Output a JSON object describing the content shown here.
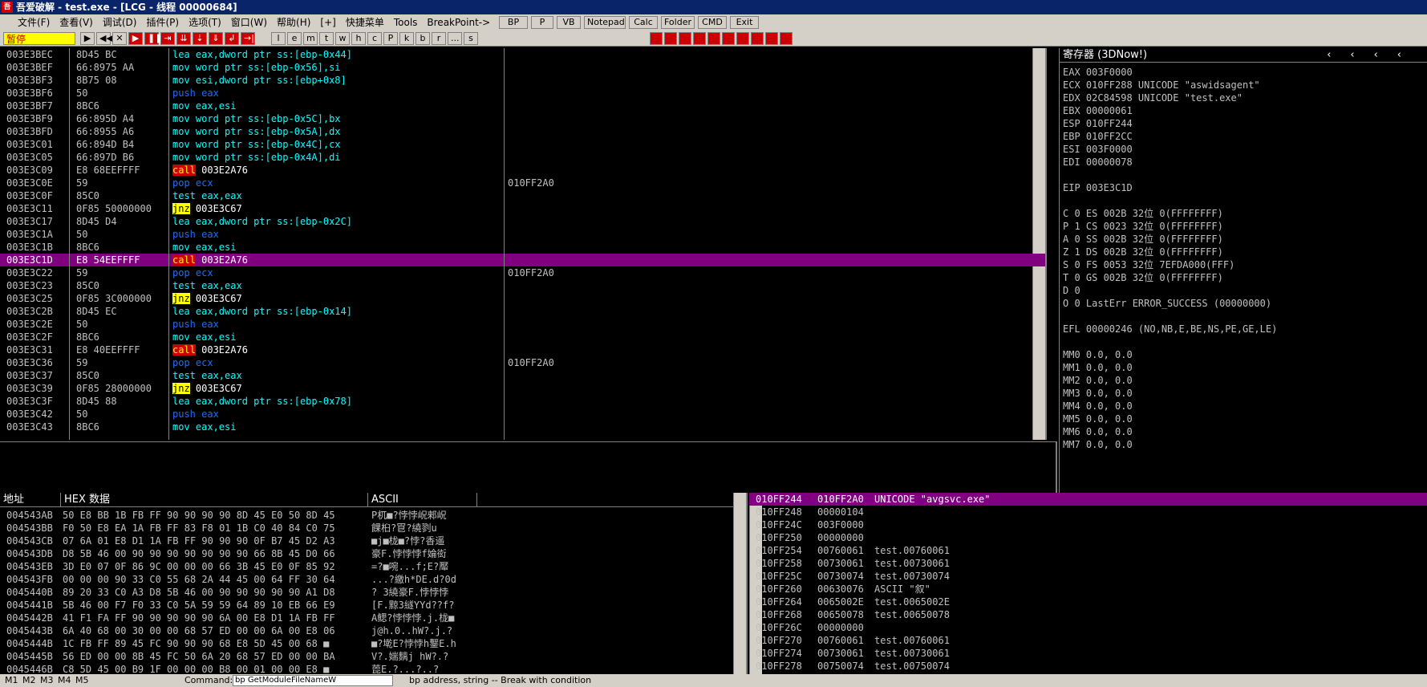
{
  "title": "吾爱破解 - test.exe - [LCG - 线程 00000684]",
  "menu": [
    "文件(F)",
    "查看(V)",
    "调试(D)",
    "插件(P)",
    "选项(T)",
    "窗口(W)",
    "帮助(H)",
    "[+]",
    "快捷菜单",
    "Tools",
    "BreakPoint->"
  ],
  "status": "暂停",
  "toolbar_letters": [
    "l",
    "e",
    "m",
    "t",
    "w",
    "h",
    "c",
    "P",
    "k",
    "b",
    "r",
    "...",
    "s"
  ],
  "quick_buttons": [
    "BP",
    "P",
    "VB",
    "Notepad",
    "Calc",
    "Folder",
    "CMD",
    "Exit"
  ],
  "disasm": [
    {
      "addr": "003E3BEC",
      "bytes": "8D45 BC",
      "op": "lea",
      "args": " eax,dword ptr ss:[ebp-0x44]",
      "cmt": ""
    },
    {
      "addr": "003E3BEF",
      "bytes": "66:8975 AA",
      "op": "mov",
      "args": " word ptr ss:[ebp-0x56],si",
      "cmt": ""
    },
    {
      "addr": "003E3BF3",
      "bytes": "8B75 08",
      "op": "mov",
      "args": " esi,dword ptr ss:[ebp+0x8]",
      "cmt": ""
    },
    {
      "addr": "003E3BF6",
      "bytes": "50",
      "op": "push",
      "args": " eax",
      "cmt": ""
    },
    {
      "addr": "003E3BF7",
      "bytes": "8BC6",
      "op": "mov",
      "args": " eax,esi",
      "cmt": ""
    },
    {
      "addr": "003E3BF9",
      "bytes": "66:895D A4",
      "op": "mov",
      "args": " word ptr ss:[ebp-0x5C],bx",
      "cmt": ""
    },
    {
      "addr": "003E3BFD",
      "bytes": "66:8955 A6",
      "op": "mov",
      "args": " word ptr ss:[ebp-0x5A],dx",
      "cmt": ""
    },
    {
      "addr": "003E3C01",
      "bytes": "66:894D B4",
      "op": "mov",
      "args": " word ptr ss:[ebp-0x4C],cx",
      "cmt": ""
    },
    {
      "addr": "003E3C05",
      "bytes": "66:897D B6",
      "op": "mov",
      "args": " word ptr ss:[ebp-0x4A],di",
      "cmt": ""
    },
    {
      "addr": "003E3C09",
      "bytes": "E8 68EEFFFF",
      "op": "call",
      "args": " 003E2A76",
      "cmt": ""
    },
    {
      "addr": "003E3C0E",
      "bytes": "59",
      "op": "pop",
      "args": " ecx",
      "cmt": "010FF2A0"
    },
    {
      "addr": "003E3C0F",
      "bytes": "85C0",
      "op": "test",
      "args": " eax,eax",
      "cmt": ""
    },
    {
      "addr": "003E3C11",
      "bytes": "0F85 50000000",
      "op": "jnz",
      "args": " 003E3C67",
      "cmt": ""
    },
    {
      "addr": "003E3C17",
      "bytes": "8D45 D4",
      "op": "lea",
      "args": " eax,dword ptr ss:[ebp-0x2C]",
      "cmt": ""
    },
    {
      "addr": "003E3C1A",
      "bytes": "50",
      "op": "push",
      "args": " eax",
      "cmt": ""
    },
    {
      "addr": "003E3C1B",
      "bytes": "8BC6",
      "op": "mov",
      "args": " eax,esi",
      "cmt": ""
    },
    {
      "addr": "003E3C1D",
      "bytes": "E8 54EEFFFF",
      "op": "call",
      "args": " 003E2A76",
      "cmt": "",
      "sel": true
    },
    {
      "addr": "003E3C22",
      "bytes": "59",
      "op": "pop",
      "args": " ecx",
      "cmt": "010FF2A0"
    },
    {
      "addr": "003E3C23",
      "bytes": "85C0",
      "op": "test",
      "args": " eax,eax",
      "cmt": ""
    },
    {
      "addr": "003E3C25",
      "bytes": "0F85 3C000000",
      "op": "jnz",
      "args": " 003E3C67",
      "cmt": ""
    },
    {
      "addr": "003E3C2B",
      "bytes": "8D45 EC",
      "op": "lea",
      "args": " eax,dword ptr ss:[ebp-0x14]",
      "cmt": ""
    },
    {
      "addr": "003E3C2E",
      "bytes": "50",
      "op": "push",
      "args": " eax",
      "cmt": ""
    },
    {
      "addr": "003E3C2F",
      "bytes": "8BC6",
      "op": "mov",
      "args": " eax,esi",
      "cmt": ""
    },
    {
      "addr": "003E3C31",
      "bytes": "E8 40EEFFFF",
      "op": "call",
      "args": " 003E2A76",
      "cmt": ""
    },
    {
      "addr": "003E3C36",
      "bytes": "59",
      "op": "pop",
      "args": " ecx",
      "cmt": "010FF2A0"
    },
    {
      "addr": "003E3C37",
      "bytes": "85C0",
      "op": "test",
      "args": " eax,eax",
      "cmt": ""
    },
    {
      "addr": "003E3C39",
      "bytes": "0F85 28000000",
      "op": "jnz",
      "args": " 003E3C67",
      "cmt": ""
    },
    {
      "addr": "003E3C3F",
      "bytes": "8D45 88",
      "op": "lea",
      "args": " eax,dword ptr ss:[ebp-0x78]",
      "cmt": ""
    },
    {
      "addr": "003E3C42",
      "bytes": "50",
      "op": "push",
      "args": " eax",
      "cmt": ""
    },
    {
      "addr": "003E3C43",
      "bytes": "8BC6",
      "op": "mov",
      "args": " eax,esi",
      "cmt": ""
    }
  ],
  "registers_title": "寄存器 (3DNow!)",
  "registers": [
    "EAX 003F0000",
    "ECX 010FF288 UNICODE \"aswidsagent\"",
    "EDX 02C84598 UNICODE \"test.exe\"",
    "EBX 00000061",
    "ESP 010FF244",
    "EBP 010FF2CC",
    "ESI 003F0000",
    "EDI 00000078",
    "",
    "EIP 003E3C1D",
    "",
    "C 0  ES 002B 32位 0(FFFFFFFF)",
    "P 1  CS 0023 32位 0(FFFFFFFF)",
    "A 0  SS 002B 32位 0(FFFFFFFF)",
    "Z 1  DS 002B 32位 0(FFFFFFFF)",
    "S 0  FS 0053 32位 7EFDA000(FFF)",
    "T 0  GS 002B 32位 0(FFFFFFFF)",
    "D 0",
    "O 0  LastErr ERROR_SUCCESS (00000000)",
    "",
    "EFL 00000246 (NO,NB,E,BE,NS,PE,GE,LE)",
    "",
    "MM0            0.0,           0.0",
    "MM1            0.0,           0.0",
    "MM2            0.0,           0.0",
    "MM3            0.0,           0.0",
    "MM4            0.0,           0.0",
    "MM5            0.0,           0.0",
    "MM6            0.0,           0.0",
    "MM7            0.0,           0.0"
  ],
  "dump_headers": {
    "addr": "地址",
    "hex": "HEX 数据",
    "ascii": "ASCII"
  },
  "dump": [
    {
      "addr": "004543AB",
      "hex": "50 E8 BB 1B FB FF 90 90 90 90 8D 45 E0 50 8D 45",
      "ascii": "P杌■?悖悖岲郲岲"
    },
    {
      "addr": "004543BB",
      "hex": "F0 50 E8 EA 1A FB FF 83 F8 01 1B C0 40 84 C0 75",
      "ascii": "餜桕?冟?繞剹u"
    },
    {
      "addr": "004543CB",
      "hex": "07 6A 01 E8 D1 1A FB FF 90 90 90 0F B7 45 D2 A3",
      "ascii": "■j■栊■?悖?香遥"
    },
    {
      "addr": "004543DB",
      "hex": "D8 5B 46 00 90 90 90 90 90 90 90 66 8B 45 D0 66",
      "ascii": "豪F.悖悖悖f婨衒"
    },
    {
      "addr": "004543EB",
      "hex": "3D E0 07 0F 86 9C 00 00 00 66 3B 45 E0 0F 85 92",
      "ascii": "=?■啘...f;E?厴"
    },
    {
      "addr": "004543FB",
      "hex": "00 00 00 90 33 C0 55 68 2A 44 45 00 64 FF 30 64",
      "ascii": "...?繳h*DE.d?0d"
    },
    {
      "addr": "0045440B",
      "hex": "89 20 33 C0 A3 D8 5B 46 00 90 90 90 90 90 A1 D8",
      "ascii": "? 3繞豪F.悖悖悖"
    },
    {
      "addr": "0045441B",
      "hex": "5B 46 00 F7 F0 33 C0 5A 59 59 64 89 10 EB 66 E9",
      "ascii": "[F.黥3繸YYd??f?"
    },
    {
      "addr": "0045442B",
      "hex": "41 F1 FA FF 90 90 90 90 90 6A 00 E8 D1 1A FB FF",
      "ascii": "A鳃?悖悖悖.j.栊■"
    },
    {
      "addr": "0045443B",
      "hex": "6A 40 68 00 30 00 00 68 57 ED 00 00 6A 00 E8 06",
      "ascii": "j@h.0..hW?.j.?"
    },
    {
      "addr": "0045444B",
      "hex": "1C FB FF 89 45 FC 90 90 90 68 E8 5D 45 00 68 ■",
      "ascii": "■?墘E?悖悖h鑋E.h"
    },
    {
      "addr": "0045445B",
      "hex": "56 ED 00 00 8B 45 FC 50 6A 20 68 57 ED 00 00 BA",
      "ascii": "V?.媏麶j hW?.?"
    },
    {
      "addr": "0045446B",
      "hex": "C8 5D 45 00 B9 1F 00 00 00 B8 00 01 00 00 E8 ■",
      "ascii": "萞E.?...?..?"
    }
  ],
  "stack": [
    {
      "addr": "010FF244",
      "val": "010FF2A0",
      "cmt": "UNICODE \"avgsvc.exe\"",
      "sel": true
    },
    {
      "addr": "010FF248",
      "val": "00000104",
      "cmt": ""
    },
    {
      "addr": "010FF24C",
      "val": "003F0000",
      "cmt": ""
    },
    {
      "addr": "010FF250",
      "val": "00000000",
      "cmt": ""
    },
    {
      "addr": "010FF254",
      "val": "00760061",
      "cmt": "test.00760061"
    },
    {
      "addr": "010FF258",
      "val": "00730061",
      "cmt": "test.00730061"
    },
    {
      "addr": "010FF25C",
      "val": "00730074",
      "cmt": "test.00730074"
    },
    {
      "addr": "010FF260",
      "val": "00630076",
      "cmt": "ASCII \"叙\""
    },
    {
      "addr": "010FF264",
      "val": "0065002E",
      "cmt": "test.0065002E"
    },
    {
      "addr": "010FF268",
      "val": "00650078",
      "cmt": "test.00650078"
    },
    {
      "addr": "010FF26C",
      "val": "00000000",
      "cmt": ""
    },
    {
      "addr": "010FF270",
      "val": "00760061",
      "cmt": "test.00760061"
    },
    {
      "addr": "010FF274",
      "val": "00730061",
      "cmt": "test.00730061"
    },
    {
      "addr": "010FF278",
      "val": "00750074",
      "cmt": "test.00750074"
    }
  ],
  "bottom": {
    "tabs": [
      "M1",
      "M2",
      "M3",
      "M4",
      "M5"
    ],
    "command_label": "Command:",
    "command_value": "bp GetModuleFileNameW",
    "hint": "bp address, string -- Break with condition"
  }
}
